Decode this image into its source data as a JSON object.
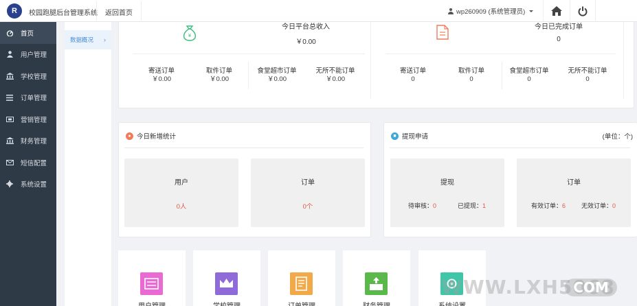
{
  "header": {
    "logo_text": "R",
    "app_title": "校园跑腿后台管理系统",
    "back_home": "返回首页",
    "user": "wp260909 (系统管理员)",
    "home_icon": "home-icon",
    "power_icon": "power-icon"
  },
  "sidebar": {
    "items": [
      {
        "label": "首页",
        "icon": "dashboard-icon",
        "active": true
      },
      {
        "label": "用户管理",
        "icon": "user-icon"
      },
      {
        "label": "学校管理",
        "icon": "bank-icon"
      },
      {
        "label": "订单管理",
        "icon": "list-icon"
      },
      {
        "label": "营销管理",
        "icon": "ticket-icon"
      },
      {
        "label": "财务管理",
        "icon": "bank-icon"
      },
      {
        "label": "短信配置",
        "icon": "mail-icon"
      },
      {
        "label": "系统设置",
        "icon": "gear-icon"
      }
    ]
  },
  "submenu": {
    "item": "数据概况",
    "chevron": "›"
  },
  "overview": {
    "income_title": "今日平台总收入",
    "income_value": "￥0.00",
    "income_stats": [
      {
        "label": "寄送订单",
        "value": "￥0.00"
      },
      {
        "label": "取件订单",
        "value": "￥0.00"
      },
      {
        "label": "食堂超市订单",
        "value": "￥0.00"
      },
      {
        "label": "无所不能订单",
        "value": "￥0.00"
      }
    ],
    "done_title": "今日已完成订单",
    "done_value": "0",
    "done_stats": [
      {
        "label": "寄送订单",
        "value": "0"
      },
      {
        "label": "取件订单",
        "value": "0"
      },
      {
        "label": "食堂超市订单",
        "value": "0"
      },
      {
        "label": "无所不能订单",
        "value": "0"
      }
    ]
  },
  "new_stats": {
    "title": "今日新增统计",
    "users_label": "用户",
    "users_value": "0人",
    "orders_label": "订单",
    "orders_value": "0个"
  },
  "withdraw": {
    "title": "提现申请",
    "unit": "(单位：个)",
    "withdraw_label": "提现",
    "pending_label": "待审核：",
    "pending_value": "0",
    "done_label": "已提现：",
    "done_value": "1",
    "orders_label": "订单",
    "valid_label": "有效订单：",
    "valid_value": "6",
    "invalid_label": "无效订单：",
    "invalid_value": "0"
  },
  "tiles": [
    {
      "label": "用户管理",
      "color": "#e86ad2"
    },
    {
      "label": "学校管理",
      "color": "#8e6bd8"
    },
    {
      "label": "订单管理",
      "color": "#f2a94a"
    },
    {
      "label": "财务管理",
      "color": "#5bb84b"
    },
    {
      "label": "系统设置",
      "color": "#3fc6a9"
    }
  ],
  "watermark": {
    "text": "WWW.LXH5068",
    "suffix": "COM"
  },
  "colors": {
    "sidebar": "#2f3a47",
    "accent_red": "#e05a47",
    "accent_blue": "#4a8bd6",
    "green_icon": "#3cbf7e",
    "orange_icon": "#f07c5a"
  }
}
